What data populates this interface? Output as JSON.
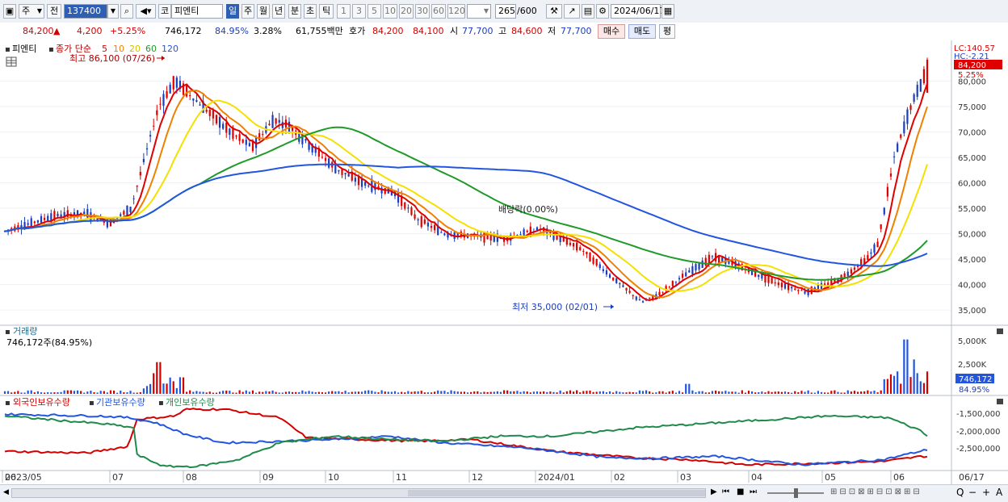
{
  "toolbar": {
    "market_type": "주",
    "market_scope": "전",
    "stock_code": "137400",
    "market_prefix": "코",
    "stock_name": "피엔티",
    "periods": [
      "일",
      "주",
      "월",
      "년",
      "분",
      "초",
      "틱"
    ],
    "selected_period": "일",
    "intervals": [
      "1",
      "3",
      "5",
      "10",
      "20",
      "30",
      "60",
      "120"
    ],
    "count_value": "265",
    "count_max": "/600",
    "date_value": "2024/06/17"
  },
  "quote": {
    "price": "84,200",
    "change": "4,200",
    "change_pct": "+5.25%",
    "volume": "746,172",
    "volume_ratio": "84.95%",
    "turnover": "3.28%",
    "amount": "61,755백만",
    "ask_label": "호가",
    "ask": "84,200",
    "bid": "84,100",
    "open_label": "시",
    "open": "77,700",
    "high_label": "고",
    "high": "84,600",
    "low_label": "저",
    "low": "77,700",
    "buy_label": "매수",
    "sell_label": "매도",
    "eval_label": "평"
  },
  "price_panel": {
    "name_label": "피엔티",
    "ma_label": "종가 단순",
    "ma_periods": [
      "5",
      "10",
      "20",
      "60",
      "120"
    ],
    "ma_colors": [
      "#e00000",
      "#f08000",
      "#f5e000",
      "#1f9a2a",
      "#2255e0"
    ],
    "max_annotation": "최고 86,100 (07/26)",
    "min_annotation": "최저 35,000 (02/01)",
    "dividend_annotation": "배당락(0.00%)",
    "lc_label": "LC:140.57",
    "hc_label": "HC:-2.21",
    "current_price_tag": "84,200",
    "current_pct_tag": "5.25%",
    "y_ticks": [
      "80,000",
      "75,000",
      "70,000",
      "65,000",
      "60,000",
      "55,000",
      "50,000",
      "45,000",
      "40,000",
      "35,000"
    ]
  },
  "volume_panel": {
    "title": "거래량",
    "value_label": "746,172주(84.95%)",
    "y_ticks": [
      "5,000K",
      "2,500K",
      "0K"
    ],
    "current_tag": "746,172",
    "current_pct": "84.95%"
  },
  "holding_panel": {
    "legend": [
      "외국인보유수량",
      "기관보유수량",
      "개인보유수량"
    ],
    "legend_colors": [
      "#d40000",
      "#2255e0",
      "#1f8a4a"
    ],
    "y_ticks": [
      "-1,500,000",
      "-2,000,000",
      "-2,500,000"
    ]
  },
  "x_axis": {
    "labels": [
      "2023/05",
      "06",
      "07",
      "08",
      "09",
      "10",
      "11",
      "12",
      "2024/01",
      "02",
      "03",
      "04",
      "05",
      "06"
    ],
    "right_label": "06/17"
  },
  "chart_data": {
    "type": "candlestick",
    "price_range": [
      32000,
      88000
    ],
    "x_range": [
      "2023-05-02",
      "2024-06-17"
    ],
    "max": {
      "date": "2023-07-26",
      "price": 86100
    },
    "min": {
      "date": "2024-02-01",
      "price": 35000
    },
    "last_close": 84200,
    "ma_last": {
      "ma5": 80500,
      "ma10": 77000,
      "ma20": 64000,
      "ma60": 48800,
      "ma120": 46000
    }
  }
}
